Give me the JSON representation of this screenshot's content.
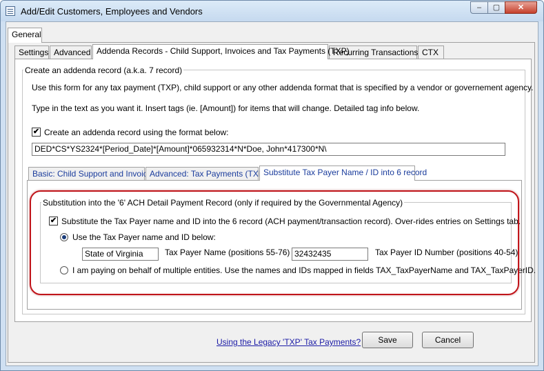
{
  "window": {
    "title": "Add/Edit Customers, Employees and Vendors",
    "controls": {
      "minimize": "–",
      "maximize": "▢",
      "close": "✕"
    }
  },
  "outer_tabs": [
    {
      "label": "General"
    }
  ],
  "inner_tabs": [
    {
      "label": "Settings"
    },
    {
      "label": "Advanced"
    },
    {
      "label": "Addenda Records - Child Support, Invoices and Tax Payments (TXP)"
    },
    {
      "label": "Recurring Transactions"
    },
    {
      "label": "CTX"
    }
  ],
  "addenda": {
    "group_label": "Create an addenda record (a.k.a. 7 record)",
    "description_1": "Use this form for any tax payment (TXP), child support or any other addenda format that is specified by a vendor or governement agency.",
    "description_2": "Type in the text as you want it.  Insert tags (ie. [Amount]) for items that will change. Detailed tag info below.",
    "create_checkbox_label": "Create an addenda record using the format below:",
    "create_checked": true,
    "format_value": "DED*CS*YS2324*[Period_Date]*[Amount]*065932314*N*Doe, John*417300*N\\"
  },
  "sub_tabs": [
    {
      "label": "Basic: Child Support and Invoices"
    },
    {
      "label": "Advanced: Tax Payments (TXP)"
    },
    {
      "label": "Substitute Tax Payer Name / ID into 6 record"
    }
  ],
  "substitution": {
    "group_label": "Substitution into the '6' ACH Detail Payment Record (only if required by the Governmental Agency)",
    "substitute_checkbox_label": "Substitute the Tax Payer name and ID into the 6 record (ACH payment/transaction record). Over-rides entries on Settings tab.",
    "substitute_checked": true,
    "radio_use_below_label": "Use the Tax Payer name and ID below:",
    "tax_payer_name_value": "State of Virginia",
    "tax_payer_name_label": "Tax Payer Name (positions 55-76)",
    "tax_payer_id_value": "32432435",
    "tax_payer_id_label": "Tax Payer ID Number (positions 40-54)",
    "radio_multiple_label": "I am paying on behalf of multiple entities.  Use the names and IDs mapped in fields TAX_TaxPayerName and TAX_TaxPayerID."
  },
  "footer": {
    "legacy_link": "Using the Legacy 'TXP' Tax Payments?",
    "save_label": "Save",
    "cancel_label": "Cancel"
  },
  "colors": {
    "highlight": "#c0141a",
    "link": "#1a1aa6"
  }
}
